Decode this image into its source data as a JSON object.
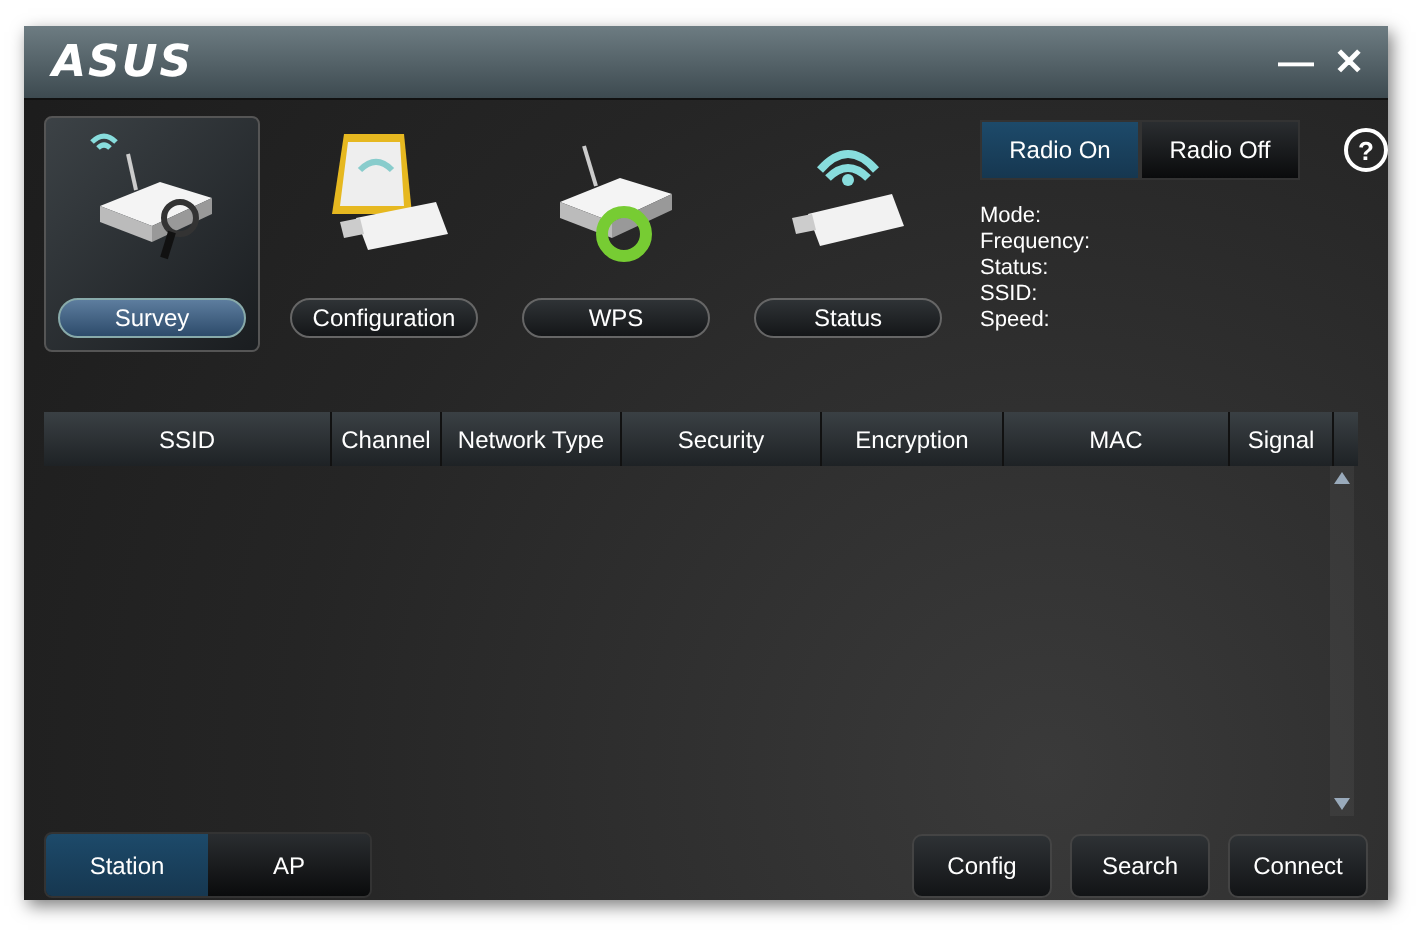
{
  "window": {
    "logo": "ASUS",
    "minimize": "—",
    "close": "✕"
  },
  "tools": [
    {
      "label": "Survey",
      "selected": true,
      "kind": "survey"
    },
    {
      "label": "Configuration",
      "selected": false,
      "kind": "config"
    },
    {
      "label": "WPS",
      "selected": false,
      "kind": "wps"
    },
    {
      "label": "Status",
      "selected": false,
      "kind": "status"
    }
  ],
  "radio": [
    {
      "label": "Radio On",
      "selected": true
    },
    {
      "label": "Radio Off",
      "selected": false
    }
  ],
  "help": "?",
  "info": [
    "Mode:",
    "Frequency:",
    "Status:",
    "SSID:",
    "Speed:"
  ],
  "table": {
    "columns": [
      "SSID",
      "Channel",
      "Network Type",
      "Security",
      "Encryption",
      "MAC",
      "Signal"
    ]
  },
  "modes": [
    {
      "label": "Station",
      "selected": true
    },
    {
      "label": "AP",
      "selected": false
    }
  ],
  "buttons": [
    "Config",
    "Search",
    "Connect"
  ]
}
